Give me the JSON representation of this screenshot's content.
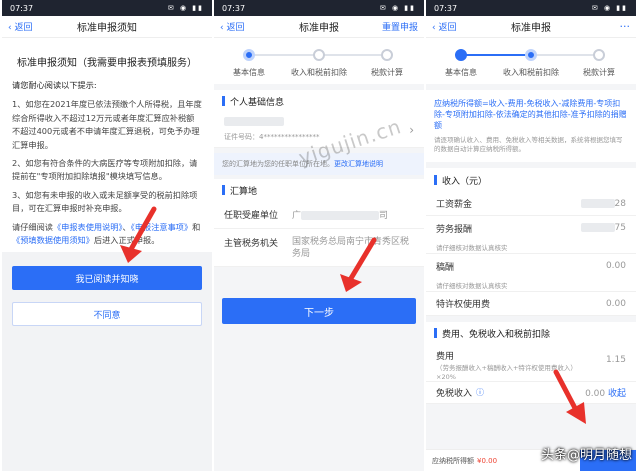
{
  "status_time": "07:37",
  "panel1": {
    "back": "返回",
    "nav_title": "标准申报须知",
    "heading": "标准申报须知（我需要申报表预填服务）",
    "intro": "请您耐心阅读以下提示:",
    "item1": "1、如您在2021年度已依法预缴个人所得税，且年度综合所得收入不超过12万元或者年度汇算应补税额不超过400元或者不申请年度汇算退税，可免予办理汇算申报。",
    "item2": "2、如您有符合条件的大病医疗等专项附加扣除，请提前在\"专项附加扣除填报\"模块填写信息。",
    "item3": "3、如您有未申报的收入或未足额享受的税前扣除项目，可在汇算申报时补充申报。",
    "read_pre": "请仔细阅读",
    "link1": "《申报表使用说明》",
    "sep": "、",
    "link2": "《申报注意事项》",
    "and": "和",
    "link3": "《预填数据使用须知》",
    "read_post": "后进入正式申报。",
    "agree_btn": "我已阅读并知晓",
    "disagree_btn": "不同意"
  },
  "panel2": {
    "back": "返回",
    "nav_title": "标准申报",
    "right_action": "重置申报",
    "steps": [
      "基本信息",
      "收入和税前扣除",
      "税款计算"
    ],
    "section_basic": "个人基础信息",
    "id_label": "证件号码：4",
    "id_mask": "****************",
    "hint_text": "您的汇算地为您的任职单位所在地。",
    "hint_link": "更改汇算地说明",
    "section_place": "汇算地",
    "employer_label": "任职受雇单位",
    "employer_value_start": "广",
    "employer_value_end": "司",
    "authority_label": "主管税务机关",
    "authority_value": "国家税务总局南宁市青秀区税务局",
    "next_btn": "下一步"
  },
  "panel3": {
    "back": "返回",
    "nav_title": "标准申报",
    "more": "···",
    "steps": [
      "基本信息",
      "收入和税前扣除",
      "税款计算"
    ],
    "formula": "应纳税所得额=收入-费用-免税收入-减除费用-专项扣除-专项附加扣除-依法确定的其他扣除-准予扣除的捐赠额",
    "formula_note": "请逐项确认收入、费用、免税收入等相关数据，系统将根据您填写的数据自动计算应纳税所得额。",
    "income_head": "收入（元）",
    "wage_label": "工资薪金",
    "wage_value": "28",
    "labor_label": "劳务报酬",
    "labor_value": "75",
    "labor_hint": "请仔细核对数据认真核实",
    "royalty_label": "稿酬",
    "royalty_value": "0.00",
    "royalty_hint": "请仔细核对数据认真核实",
    "franchise_label": "特许权使用费",
    "franchise_value": "0.00",
    "deduct_head": "费用、免税收入和税前扣除",
    "fee_label": "费用",
    "fee_desc": "（劳务报酬收入+稿酬收入+特许权使用费收入）×20%",
    "fee_value": "1.15",
    "exempt_label": "免税收入",
    "exempt_value": "0.00",
    "exempt_toggle": "收起",
    "footer_label": "应纳税所得额",
    "footer_amount": "¥0.00"
  },
  "watermark": "yigujin.cn",
  "author": "头条@明月随想"
}
